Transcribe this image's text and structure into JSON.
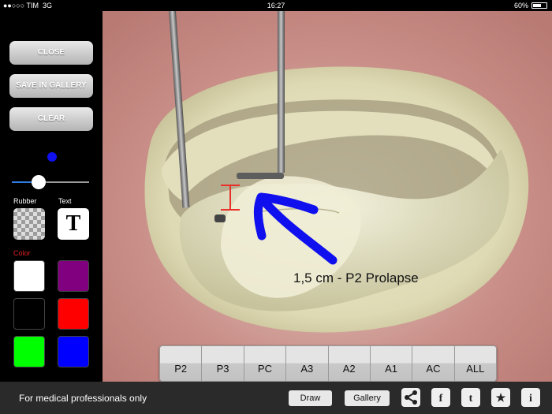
{
  "status_bar": {
    "carrier": "●●○○○ TIM",
    "network": "3G",
    "time": "16:27",
    "battery": "60%",
    "battery_level": 0.6
  },
  "side_panel": {
    "close_label": "CLOSE",
    "save_label": "SAVE IN GALLERY",
    "clear_label": "CLEAR",
    "brush_color": "#1010ee",
    "brush_size": 0.35,
    "rubber_label": "Rubber",
    "text_label": "Text",
    "text_tool_glyph": "T",
    "color_label": "Color",
    "colors": [
      "#ffffff",
      "#800080",
      "#000000",
      "#ff0000",
      "#00ff00",
      "#0000ff"
    ]
  },
  "annotation": {
    "text": "1,5 cm - P2 Prolapse",
    "measure_color": "#e8312a",
    "arrow_color": "#1010ee"
  },
  "segments": [
    "P2",
    "P3",
    "PC",
    "A3",
    "A2",
    "A1",
    "AC",
    "ALL"
  ],
  "bottom_bar": {
    "note": "For medical professionals only",
    "draw_label": "Draw",
    "gallery_label": "Gallery",
    "icons": [
      "share-icon",
      "facebook-icon",
      "twitter-icon",
      "star-icon",
      "info-icon"
    ]
  }
}
